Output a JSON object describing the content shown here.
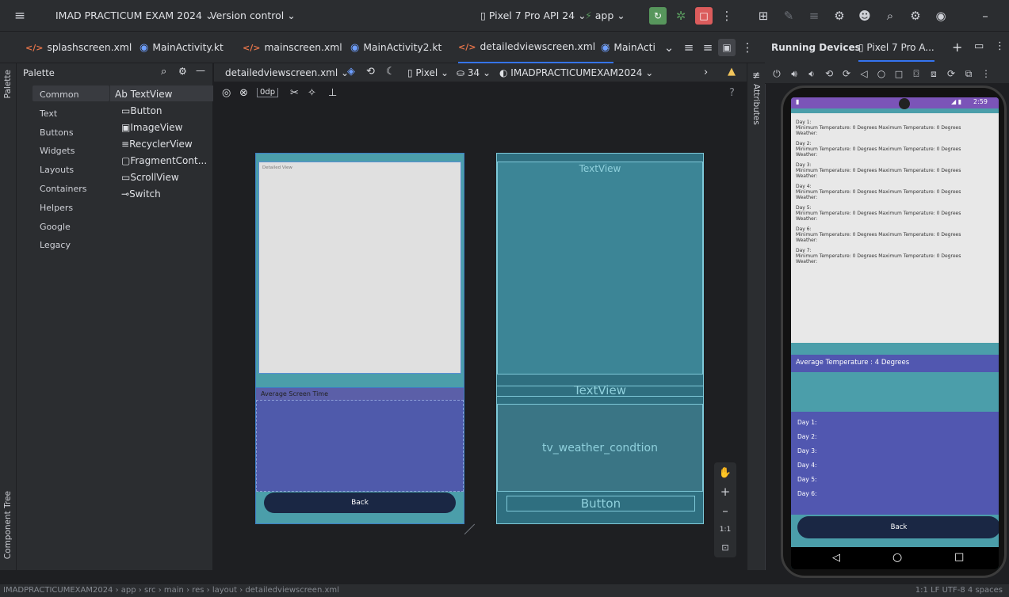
{
  "titlebar": {
    "project": "IMAD PRACTICUM EXAM 2024",
    "vcs": "Version control",
    "device": "Pixel 7 Pro API 24",
    "run_config": "app",
    "icons": [
      "hamburger-icon",
      "run-icon",
      "debug-icon",
      "stop-icon",
      "more-icon",
      "profiler-icon",
      "translate-icon",
      "build-icon",
      "sync-icon",
      "user-icon",
      "search-icon",
      "settings-icon",
      "account-icon",
      "minimize-icon"
    ]
  },
  "tabs": [
    {
      "label": "splashscreen.xml",
      "type": "xml"
    },
    {
      "label": "MainActivity.kt",
      "type": "kt"
    },
    {
      "label": "mainscreen.xml",
      "type": "xml"
    },
    {
      "label": "MainActivity2.kt",
      "type": "kt"
    },
    {
      "label": "detailedviewscreen.xml",
      "type": "xml",
      "active": true
    },
    {
      "label": "MainActi",
      "type": "kt"
    }
  ],
  "sidestrips": {
    "palette": "Palette",
    "component_tree": "Component Tree",
    "attributes": "Attributes"
  },
  "palette": {
    "title": "Palette",
    "categories": [
      "Common",
      "Text",
      "Buttons",
      "Widgets",
      "Layouts",
      "Containers",
      "Helpers",
      "Google",
      "Legacy"
    ],
    "components": [
      {
        "label": "TextView",
        "icon": "Ab"
      },
      {
        "label": "Button",
        "icon": "▭"
      },
      {
        "label": "ImageView",
        "icon": "▣"
      },
      {
        "label": "RecyclerView",
        "icon": "≡"
      },
      {
        "label": "FragmentCont...",
        "icon": "▢"
      },
      {
        "label": "ScrollView",
        "icon": "▭"
      },
      {
        "label": "Switch",
        "icon": "⊸"
      }
    ]
  },
  "editor": {
    "file_dropdown": "detailedviewscreen.xml",
    "device_dropdown": "Pixel",
    "api_dropdown": "34",
    "theme_dropdown": "IMADPRACTICUMEXAM2024",
    "margin_value": "0dp",
    "help": "?"
  },
  "design": {
    "detailed_view_label": "Detailed View",
    "avg_screen_time": "Average Screen Time",
    "back_button": "Back"
  },
  "blueprint": {
    "textview1": "TextView",
    "textview2": "TextView",
    "weather": "tv_weather_condtion",
    "button": "Button"
  },
  "zoom": {
    "fit": "1:1"
  },
  "running_devices": {
    "title": "Running Devices",
    "device_tab": "Pixel 7 Pro A...",
    "status_time": "2:59",
    "days": [
      {
        "day": "Day 1:",
        "line": "Minimum Temperature: 0 Degrees   Maximum Temperature: 0 Degrees",
        "weather": "Weather:"
      },
      {
        "day": "Day 2:",
        "line": "Minimum Temperature: 0 Degrees   Maximum Temperature: 0 Degrees",
        "weather": "Weather:"
      },
      {
        "day": "Day 3:",
        "line": "Minimum Temperature: 0 Degrees   Maximum Temperature: 0 Degrees",
        "weather": "Weather:"
      },
      {
        "day": "Day 4:",
        "line": "Minimum Temperature: 0 Degrees   Maximum Temperature: 0 Degrees",
        "weather": "Weather:"
      },
      {
        "day": "Day 5:",
        "line": "Minimum Temperature: 0 Degrees   Maximum Temperature: 0 Degrees",
        "weather": "Weather:"
      },
      {
        "day": "Day 6:",
        "line": "Minimum Temperature: 0 Degrees   Maximum Temperature: 0 Degrees",
        "weather": "Weather:"
      },
      {
        "day": "Day 7:",
        "line": "Minimum Temperature: 0 Degrees   Maximum Temperature: 0 Degrees",
        "weather": "Weather:"
      }
    ],
    "average": "Average Temperature : 4 Degrees",
    "day_labels": [
      "Day 1:",
      "Day 2:",
      "Day 3:",
      "Day 4:",
      "Day 5:",
      "Day 6:"
    ],
    "back_button": "Back"
  },
  "statusbar": {
    "breadcrumb": "IMADPRACTICUMEXAM2024 › app › src › main › res › layout › detailedviewscreen.xml",
    "right": "1:1   LF   UTF-8   4 spaces"
  },
  "colors": {
    "accent": "#3574f0",
    "teal": "#4b9eaa",
    "indigo": "#4f5aab",
    "navy": "#1a2744",
    "run": "#57965c",
    "stop": "#db5c5c"
  }
}
